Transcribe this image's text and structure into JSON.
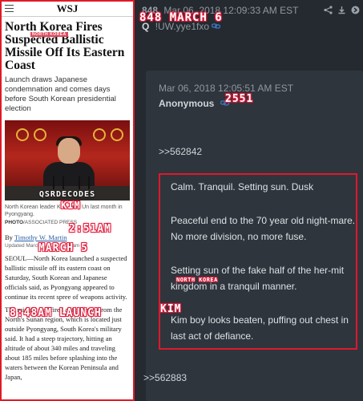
{
  "left": {
    "logo": "WSJ",
    "headline": "North Korea Fires Suspected Ballistic Missile Off Its Eastern Coast",
    "dek": "Launch draws Japanese condemnation and comes days before South Korean presidential election",
    "photo_watermark": "QSRDECODES",
    "caption": "North Korean leader Kim Jong Un last month in Pyongyang.",
    "credit_label": "PHOTO",
    "credit_source": "/ASSOCIATED PRESS",
    "byline_prefix": "By",
    "byline_author": "Timothy W. Martin",
    "updated": "Updated March 5, 2022 2:51 am ET",
    "para1": "SEOUL—North Korea launched a suspected ballistic missile off its eastern coast on Saturday, South Korean and Japanese officials said, as Pyongyang appeared to continue its recent spree of weapons activity.",
    "para2": "The missile was fired at 8:48 a.m. from the North's Sunan region, which is located just outside Pyongyang, South Korea's military said. It had a steep trajectory, hitting an altitude of about 340 miles and traveling about 185 miles before splashing into the waters between the Korean Peninsula and Japan,"
  },
  "annotations": {
    "kim": "KIM",
    "time": "2:51AM",
    "march5": "MARCH 5",
    "launch": "8:48AM LAUNCH",
    "header_tag": "848 MARCH 6",
    "post_tag": "2551",
    "nk": "NORTH KOREA",
    "kim2": "KIM",
    "small_tag": "NORTH KOREA"
  },
  "post": {
    "number": "848",
    "datetime": "Mar 06, 2018 12:09:33 AM EST",
    "q_label": "Q",
    "tripcode": "!UW.yye1fxo",
    "reply_datetime": "Mar 06, 2018 12:05:51 AM EST",
    "reply_name": "Anonymous",
    "ref_top": ">>562842",
    "message": [
      "Calm. Tranquil. Setting sun. Dusk",
      "Peaceful end to the 70 year old night-mare. No more division, no more fuse.",
      "Setting sun of the fake half of the her-mit kingdom in a tranquil manner.",
      "Kim boy looks beaten, puffing out chest in last act of defiance."
    ],
    "ref_bottom": ">>562883"
  },
  "icons": [
    "share-icon",
    "download-icon",
    "arrow-icon",
    "link-icon"
  ],
  "colors": {
    "accent_red": "#e0182c",
    "link": "#3f79c9",
    "panel": "#2e353c"
  }
}
